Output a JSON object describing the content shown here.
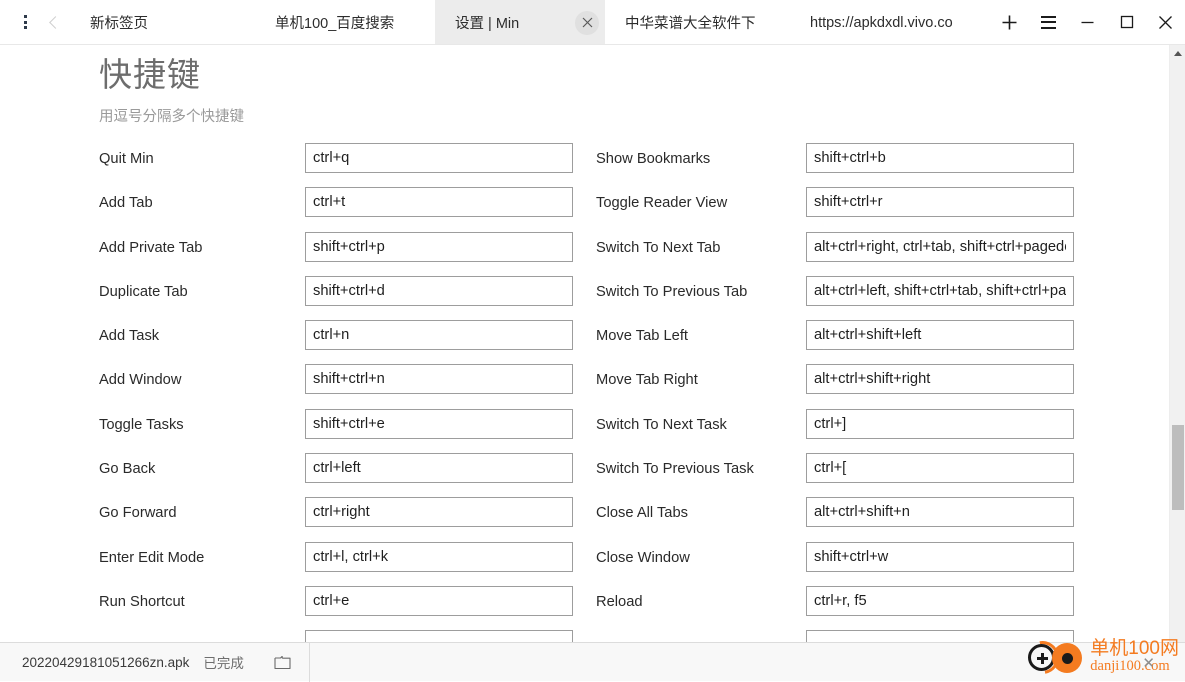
{
  "window": {
    "kebab_icon": "more-vertical-icon",
    "back_icon": "chevron-left-icon",
    "new_tab_label": "+",
    "menu_icon": "hamburger-menu-icon",
    "minimize_icon": "minimize-icon",
    "maximize_icon": "maximize-icon",
    "close_icon": "close-icon"
  },
  "tabs": [
    {
      "title": "新标签页",
      "active": false
    },
    {
      "title": "单机100_百度搜索",
      "active": false
    },
    {
      "title": "设置 | Min",
      "active": true,
      "close_icon": "close-icon"
    },
    {
      "title": "中华菜谱大全软件下",
      "active": false
    },
    {
      "title": "https://apkdxdl.vivo.co",
      "active": false
    }
  ],
  "page": {
    "heading": "快捷键",
    "subheading": "用逗号分隔多个快捷键"
  },
  "shortcuts": {
    "left_column": [
      {
        "label": "Quit Min",
        "value": "ctrl+q"
      },
      {
        "label": "Add Tab",
        "value": "ctrl+t"
      },
      {
        "label": "Add Private Tab",
        "value": "shift+ctrl+p"
      },
      {
        "label": "Duplicate Tab",
        "value": "shift+ctrl+d"
      },
      {
        "label": "Add Task",
        "value": "ctrl+n"
      },
      {
        "label": "Add Window",
        "value": "shift+ctrl+n"
      },
      {
        "label": "Toggle Tasks",
        "value": "shift+ctrl+e"
      },
      {
        "label": "Go Back",
        "value": "ctrl+left"
      },
      {
        "label": "Go Forward",
        "value": "ctrl+right"
      },
      {
        "label": "Enter Edit Mode",
        "value": "ctrl+l, ctrl+k"
      },
      {
        "label": "Run Shortcut",
        "value": "ctrl+e"
      },
      {
        "label": "",
        "value": ""
      }
    ],
    "right_column": [
      {
        "label": "Show Bookmarks",
        "value": "shift+ctrl+b"
      },
      {
        "label": "Toggle Reader View",
        "value": "shift+ctrl+r"
      },
      {
        "label": "Switch To Next Tab",
        "value": "alt+ctrl+right, ctrl+tab, shift+ctrl+pagedown"
      },
      {
        "label": "Switch To Previous Tab",
        "value": "alt+ctrl+left, shift+ctrl+tab, shift+ctrl+pageup"
      },
      {
        "label": "Move Tab Left",
        "value": "alt+ctrl+shift+left"
      },
      {
        "label": "Move Tab Right",
        "value": "alt+ctrl+shift+right"
      },
      {
        "label": "Switch To Next Task",
        "value": "ctrl+]"
      },
      {
        "label": "Switch To Previous Task",
        "value": "ctrl+["
      },
      {
        "label": "Close All Tabs",
        "value": "alt+ctrl+shift+n"
      },
      {
        "label": "Close Window",
        "value": "shift+ctrl+w"
      },
      {
        "label": "Reload",
        "value": "ctrl+r, f5"
      },
      {
        "label": "",
        "value": ""
      }
    ]
  },
  "scrollbar": {
    "up_icon": "triangle-up-icon",
    "down_icon": "triangle-down-icon"
  },
  "download_bar": {
    "file_name": "20220429181051266zn.apk",
    "status": "已完成",
    "folder_icon": "folder-icon"
  },
  "watermark": {
    "cn": "单机100网",
    "en": "danji100.com",
    "close_label": "✕",
    "accent_color": "#f47b20"
  }
}
